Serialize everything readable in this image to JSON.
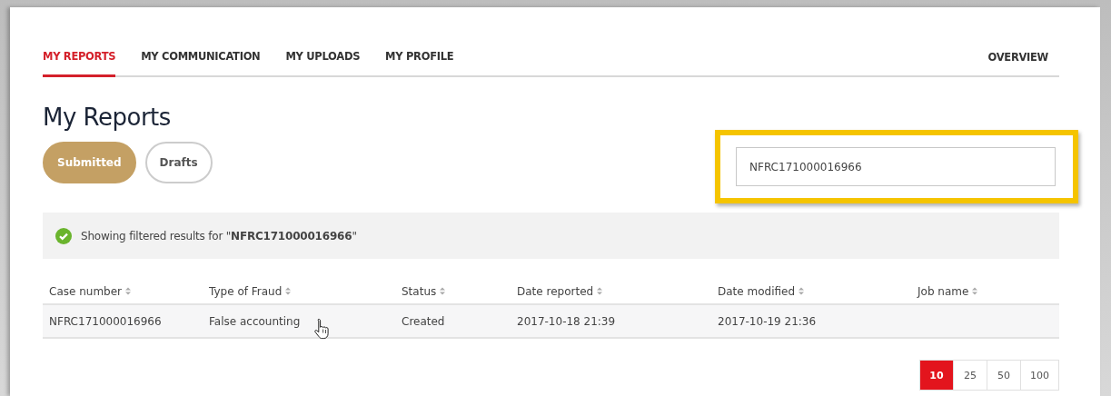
{
  "tabs": [
    {
      "label": "MY REPORTS",
      "selected": true
    },
    {
      "label": "MY COMMUNICATION",
      "selected": false
    },
    {
      "label": "MY UPLOADS",
      "selected": false
    },
    {
      "label": "MY PROFILE",
      "selected": false
    }
  ],
  "overview_link": "OVERVIEW",
  "heading": "My Reports",
  "filters": [
    {
      "label": "Submitted",
      "selected": true
    },
    {
      "label": "Drafts",
      "selected": false
    }
  ],
  "search": {
    "value": "NFRC171000016966"
  },
  "banner": {
    "text": "Showing filtered results for \"**NFRC171000016966**\""
  },
  "table": {
    "columns": [
      "Case number",
      "Type of Fraud",
      "Status",
      "Date reported",
      "Date modified",
      "Job name"
    ],
    "rows": [
      {
        "cells": [
          "NFRC171000016966",
          "False accounting",
          "Created",
          "2017-10-18 21:39",
          "2017-10-19 21:36",
          null
        ]
      }
    ]
  },
  "page_sizes": [
    {
      "label": "10",
      "selected": true
    },
    {
      "label": "25",
      "selected": false
    },
    {
      "label": "50",
      "selected": false
    },
    {
      "label": "100",
      "selected": false
    }
  ]
}
